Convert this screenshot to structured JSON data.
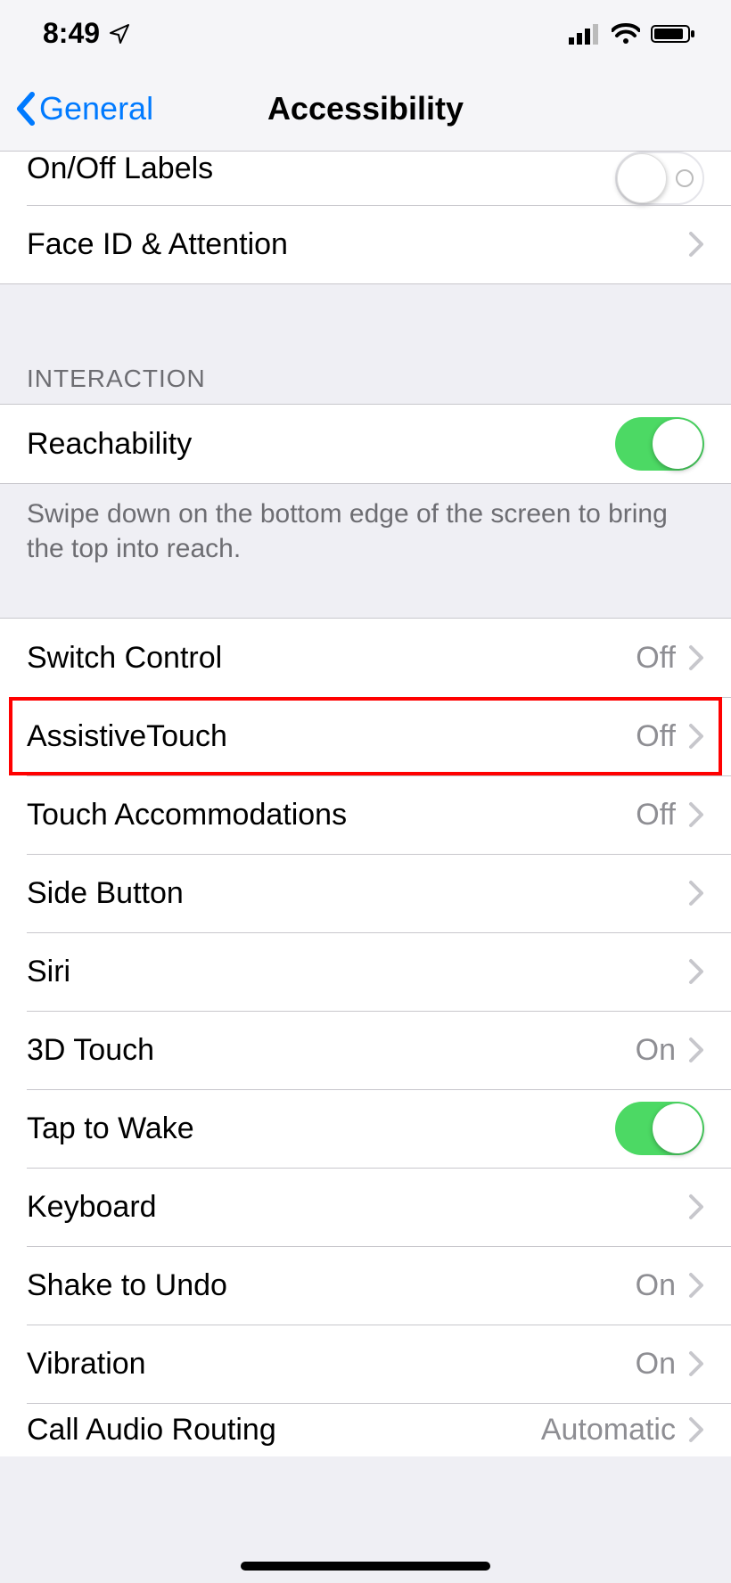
{
  "status": {
    "time": "8:49"
  },
  "nav": {
    "back": "General",
    "title": "Accessibility"
  },
  "rows": {
    "onoff_labels": {
      "label": "On/Off Labels",
      "on": false
    },
    "faceid": {
      "label": "Face ID & Attention"
    },
    "section_interaction_header": "INTERACTION",
    "reachability": {
      "label": "Reachability",
      "on": true
    },
    "reachability_footer": "Swipe down on the bottom edge of the screen to bring the top into reach.",
    "switch_control": {
      "label": "Switch Control",
      "value": "Off"
    },
    "assistive_touch": {
      "label": "AssistiveTouch",
      "value": "Off"
    },
    "touch_accommodations": {
      "label": "Touch Accommodations",
      "value": "Off"
    },
    "side_button": {
      "label": "Side Button"
    },
    "siri": {
      "label": "Siri"
    },
    "threed_touch": {
      "label": "3D Touch",
      "value": "On"
    },
    "tap_to_wake": {
      "label": "Tap to Wake",
      "on": true
    },
    "keyboard": {
      "label": "Keyboard"
    },
    "shake_to_undo": {
      "label": "Shake to Undo",
      "value": "On"
    },
    "vibration": {
      "label": "Vibration",
      "value": "On"
    },
    "call_audio_routing": {
      "label": "Call Audio Routing",
      "value": "Automatic"
    }
  }
}
